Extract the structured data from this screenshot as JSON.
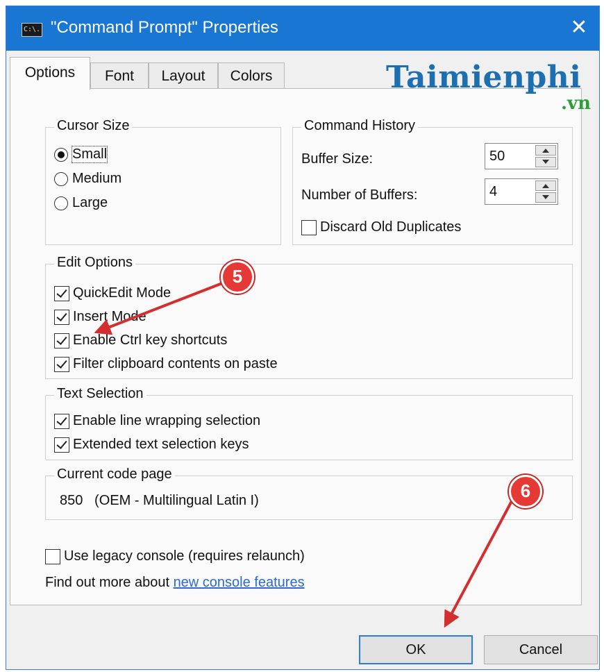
{
  "window": {
    "title": "\"Command Prompt\" Properties",
    "close_glyph": "✕",
    "icon_text": "C:\\."
  },
  "tabs": [
    {
      "label": "Options",
      "active": true
    },
    {
      "label": "Font",
      "active": false
    },
    {
      "label": "Layout",
      "active": false
    },
    {
      "label": "Colors",
      "active": false
    }
  ],
  "watermark": {
    "main": "Taimienphi",
    "sub": ".vn"
  },
  "cursor_size": {
    "title": "Cursor Size",
    "options": [
      {
        "label": "Small",
        "selected": true
      },
      {
        "label": "Medium",
        "selected": false
      },
      {
        "label": "Large",
        "selected": false
      }
    ]
  },
  "command_history": {
    "title": "Command History",
    "buffer_size_label": "Buffer Size:",
    "buffer_size_value": "50",
    "num_buffers_label": "Number of Buffers:",
    "num_buffers_value": "4",
    "discard_label": "Discard Old Duplicates",
    "discard_checked": false
  },
  "edit_options": {
    "title": "Edit Options",
    "items": [
      {
        "label": "QuickEdit Mode",
        "checked": true
      },
      {
        "label": "Insert Mode",
        "checked": true
      },
      {
        "label": "Enable Ctrl key shortcuts",
        "checked": true
      },
      {
        "label": "Filter clipboard contents on paste",
        "checked": true
      }
    ]
  },
  "text_selection": {
    "title": "Text Selection",
    "items": [
      {
        "label": "Enable line wrapping selection",
        "checked": true
      },
      {
        "label": "Extended text selection keys",
        "checked": true
      }
    ]
  },
  "code_page": {
    "title": "Current code page",
    "value": "850   (OEM - Multilingual Latin I)"
  },
  "legacy": {
    "label": "Use legacy console (requires relaunch)",
    "checked": false
  },
  "find_more": {
    "text": "Find out more about ",
    "link": "new console features"
  },
  "buttons": {
    "ok": "OK",
    "cancel": "Cancel"
  },
  "annotations": {
    "step5": "5",
    "step6": "6",
    "arrow_color": "#d32f2f"
  }
}
